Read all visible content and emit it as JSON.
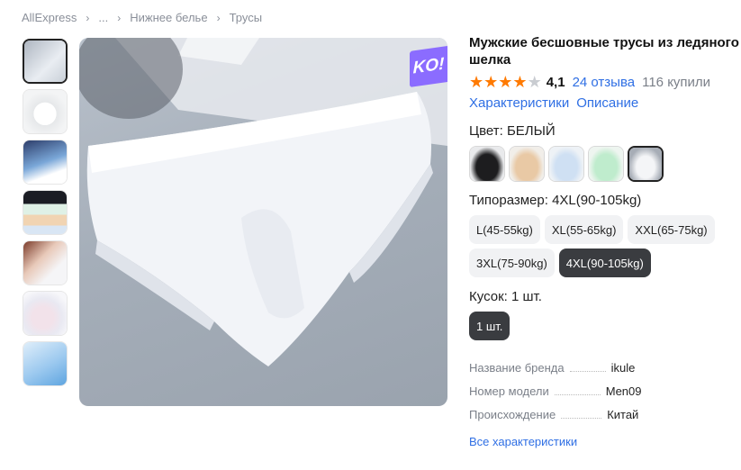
{
  "breadcrumb": [
    "AllExpress",
    "...",
    "Нижнее белье",
    "Трусы"
  ],
  "breadcrumb_sep": "›",
  "badge": "KO!",
  "product": {
    "title": "Мужские бесшовные трусы из ледяного шелка",
    "rating": "4,1",
    "reviews": "24 отзыва",
    "sold": "116 купили",
    "stars_filled": 4,
    "tab_specs": "Характеристики",
    "tab_description": "Описание"
  },
  "color": {
    "label": "Цвет: БЕЛЫЙ",
    "swatches": [
      {
        "name": "black",
        "hex": "#1d1d1f"
      },
      {
        "name": "beige",
        "hex": "#e9c9a5"
      },
      {
        "name": "light-blue",
        "hex": "#cfe0f3"
      },
      {
        "name": "mint",
        "hex": "#bfeccd"
      },
      {
        "name": "white",
        "hex": "#e8eaee"
      }
    ],
    "selected": 4
  },
  "size": {
    "label": "Типоразмер: 4XL(90-105kg)",
    "options": [
      "L(45-55kg)",
      "XL(55-65kg)",
      "XXL(65-75kg)",
      "3XL(75-90kg)",
      "4XL(90-105kg)"
    ],
    "selected": 4
  },
  "quantity": {
    "label": "Кусок: 1 шт.",
    "options": [
      "1 шт."
    ],
    "selected": 0
  },
  "specs": [
    {
      "key": "Название бренда",
      "value": "ikule"
    },
    {
      "key": "Номер модели",
      "value": "Men09"
    },
    {
      "key": "Происхождение",
      "value": "Китай"
    }
  ],
  "all_specs_link": "Все характеристики",
  "thumb_count": 7,
  "colors": {
    "accent_blue": "#2f6fe4",
    "star_orange": "#ff7a00",
    "dark_btn": "#3a3c40"
  }
}
